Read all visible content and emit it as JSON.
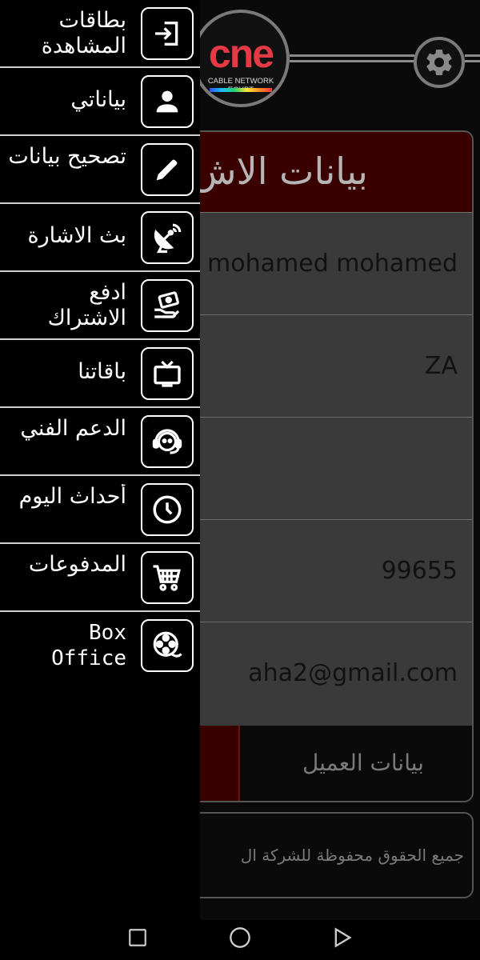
{
  "brand": {
    "logo_text": "cne",
    "logo_subtitle": "CABLE NETWORK EGYPT"
  },
  "card": {
    "title": "بيانات الاش",
    "fields": [
      "ed mohamed mohamed",
      "ZA",
      "",
      "99655",
      "aha2@gmail.com"
    ],
    "tab_customer": "بيانات العميل"
  },
  "footer": {
    "text": "جميع الحقوق محفوظة للشركة ال"
  },
  "drawer": {
    "items": [
      {
        "label": "بطاقات المشاهدة",
        "icon": "login-icon"
      },
      {
        "label": "بياناتي",
        "icon": "user-icon"
      },
      {
        "label": "تصحيح بيانات",
        "icon": "pencil-icon"
      },
      {
        "label": "بث الاشارة",
        "icon": "satellite-dish-icon"
      },
      {
        "label": "ادفع الاشتراك",
        "icon": "payment-hand-icon"
      },
      {
        "label": "باقاتنا",
        "icon": "tv-icon"
      },
      {
        "label": "الدعم الفني",
        "icon": "support-agent-icon"
      },
      {
        "label": "أحداث اليوم",
        "icon": "clock-icon"
      },
      {
        "label": "المدفوعات",
        "icon": "cart-icon"
      },
      {
        "label": "Box Office",
        "icon": "film-reel-icon"
      }
    ]
  },
  "colors": {
    "accent_red": "#e53945",
    "header_dark_red": "#3a0000",
    "card_gray": "#3a3a3a"
  }
}
